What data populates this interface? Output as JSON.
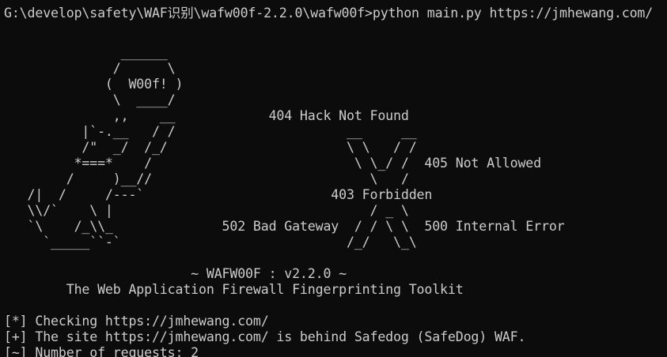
{
  "terminal": {
    "prompt_line": "G:\\develop\\safety\\WAF识别\\wafw00f-2.2.0\\wafw00f>python main.py https://jmhewang.com/",
    "banner": [
      "               ______",
      "              /      \\",
      "             (  W00f! )",
      "              \\  ____/",
      "              ,,    __            404 Hack Not Found",
      "          |`-.__   / /                      __     __",
      "          /\"  _/  /_/                       \\ \\   / /",
      "         *===*    /                          \\ \\_/ /  405 Not Allowed",
      "        /     )__//                            \\   /",
      "   /|  /     /---`                        403 Forbidden",
      "   \\\\/`    \\ |                                 / _ \\",
      "   `\\    /_\\\\_              502 Bad Gateway  / / \\ \\  500 Internal Error",
      "     `_____``-`                             /_/   \\_\\",
      "",
      "                        ~ WAFW00F : v2.2.0 ~",
      "        The Web Application Firewall Fingerprinting Toolkit"
    ],
    "output": [
      "[*] Checking https://jmhewang.com/",
      "[+] The site https://jmhewang.com/ is behind Safedog (SafeDog) WAF.",
      "[~] Number of requests: 2"
    ]
  },
  "colors": {
    "background": "#0c0c0c",
    "text": "#cccccc"
  }
}
